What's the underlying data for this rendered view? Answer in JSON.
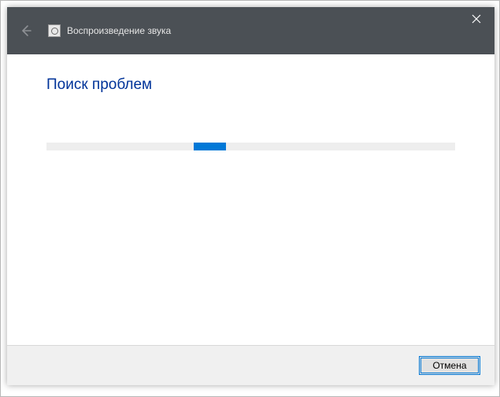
{
  "titlebar": {
    "title": "Воспроизведение звука"
  },
  "content": {
    "heading": "Поиск проблем"
  },
  "progress": {
    "chunk_left_percent": 36,
    "chunk_width_percent": 8
  },
  "footer": {
    "cancel_label": "Отмена"
  }
}
